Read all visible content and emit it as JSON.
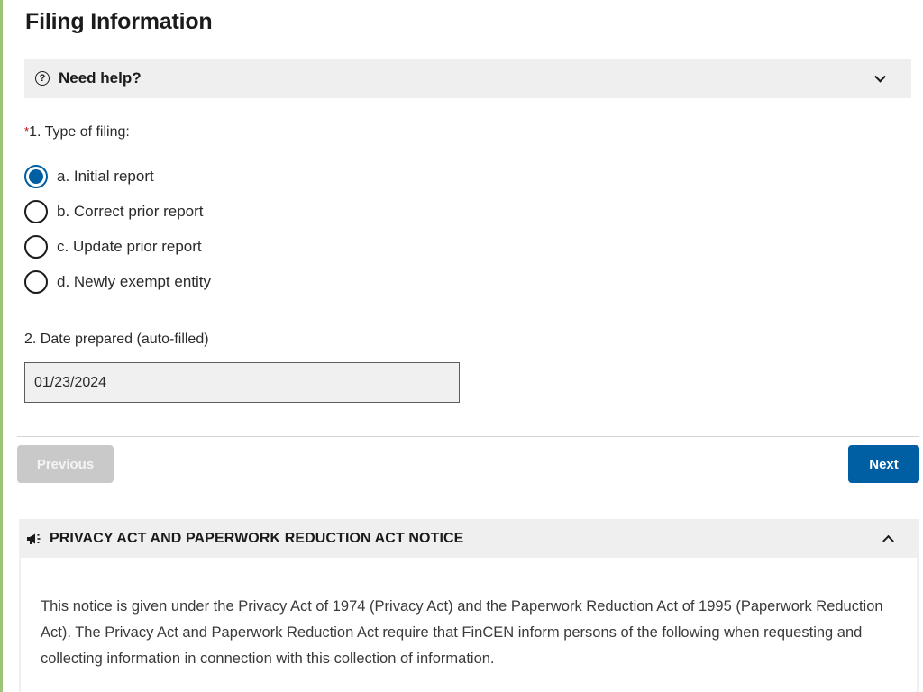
{
  "page": {
    "title": "Filing Information"
  },
  "help": {
    "label": "Need help?",
    "icon": "question-circle-icon",
    "expanded": false
  },
  "question1": {
    "required_marker": "*",
    "label": "1. Type of filing:",
    "selected": "a",
    "options": [
      {
        "key": "a",
        "label": "a. Initial report",
        "checked": true
      },
      {
        "key": "b",
        "label": "b. Correct prior report",
        "checked": false
      },
      {
        "key": "c",
        "label": "c. Update prior report",
        "checked": false
      },
      {
        "key": "d",
        "label": "d. Newly exempt entity",
        "checked": false
      }
    ]
  },
  "question2": {
    "label": "2. Date prepared (auto-filled)",
    "value": "01/23/2024"
  },
  "navigation": {
    "previous_label": "Previous",
    "previous_disabled": true,
    "next_label": "Next"
  },
  "notice": {
    "icon": "megaphone-icon",
    "title": "PRIVACY ACT AND PAPERWORK REDUCTION ACT NOTICE",
    "expanded": true,
    "body": "This notice is given under the Privacy Act of 1974 (Privacy Act) and the Paperwork Reduction Act of 1995 (Paperwork Reduction Act). The Privacy Act and Paperwork Reduction Act require that FinCEN inform persons of the following when requesting and collecting information in connection with this collection of information."
  },
  "colors": {
    "primary": "#005ea2",
    "disabled_button": "#c9c9c9",
    "accordion_bg": "#efefef",
    "required": "#b50909",
    "left_rule": "#9bc47a"
  }
}
